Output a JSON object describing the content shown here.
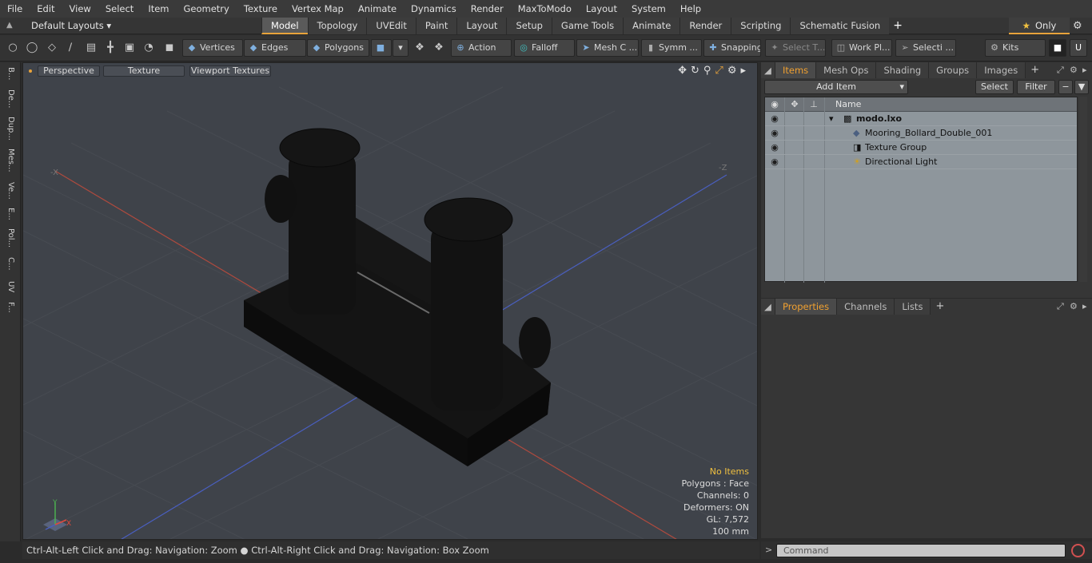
{
  "menu": [
    "File",
    "Edit",
    "View",
    "Select",
    "Item",
    "Geometry",
    "Texture",
    "Vertex Map",
    "Animate",
    "Dynamics",
    "Render",
    "MaxToModo",
    "Layout",
    "System",
    "Help"
  ],
  "layoutbar": {
    "layouts_label": "Default Layouts ▾",
    "tabs": [
      "Model",
      "Topology",
      "UVEdit",
      "Paint",
      "Layout",
      "Setup",
      "Game Tools",
      "Animate",
      "Render",
      "Scripting",
      "Schematic Fusion"
    ],
    "active_tab": "Model",
    "add_tab": "+",
    "only_label": "Only"
  },
  "toolbar": {
    "vertices": "Vertices",
    "edges": "Edges",
    "polygons": "Polygons",
    "action": "Action",
    "falloff": "Falloff",
    "mesh": "Mesh C ...",
    "symm": "Symm ...",
    "snapping": "Snapping",
    "select_t": "Select T...",
    "work_pl": "Work Pl...",
    "selecti": "Selecti ...",
    "kits": "Kits"
  },
  "left_tabs": [
    "B...",
    "De...",
    "Dup...",
    "Mes...",
    "Ve...",
    "E...",
    "Pol...",
    "C...",
    "UV",
    "F..."
  ],
  "viewport": {
    "buttons": [
      "Perspective",
      "Texture",
      "Viewport Textures"
    ],
    "axis_labels": {
      "neg_x": "-X",
      "neg_z": "-Z",
      "x": "X",
      "y": "Y"
    },
    "stats": {
      "no_items": "No Items",
      "polygons": "Polygons : Face",
      "channels": "Channels: 0",
      "deformers": "Deformers: ON",
      "gl": "GL: 7,572",
      "scale": "100 mm"
    }
  },
  "statusbar": {
    "text": "Ctrl-Alt-Left Click and Drag: Navigation: Zoom ● Ctrl-Alt-Right Click and Drag: Navigation: Box Zoom"
  },
  "items_panel": {
    "tabs": [
      "Items",
      "Mesh Ops",
      "Shading",
      "Groups",
      "Images"
    ],
    "active_tab": "Items",
    "add_item": "Add Item",
    "select": "Select",
    "filter": "Filter",
    "column_name": "Name",
    "rows": [
      {
        "name": "modo.lxo",
        "icon": "scene-icon"
      },
      {
        "name": "Mooring_Bollard_Double_001",
        "icon": "mesh-icon"
      },
      {
        "name": "Texture Group",
        "icon": "texture-group-icon"
      },
      {
        "name": "Directional Light",
        "icon": "light-icon"
      }
    ]
  },
  "properties_panel": {
    "tabs": [
      "Properties",
      "Channels",
      "Lists"
    ],
    "active_tab": "Properties"
  },
  "command": {
    "placeholder": "Command"
  },
  "colors": {
    "accent": "#e8a33b",
    "viewport_bg": "#3f434a",
    "item_list_bg": "#8e969c"
  }
}
